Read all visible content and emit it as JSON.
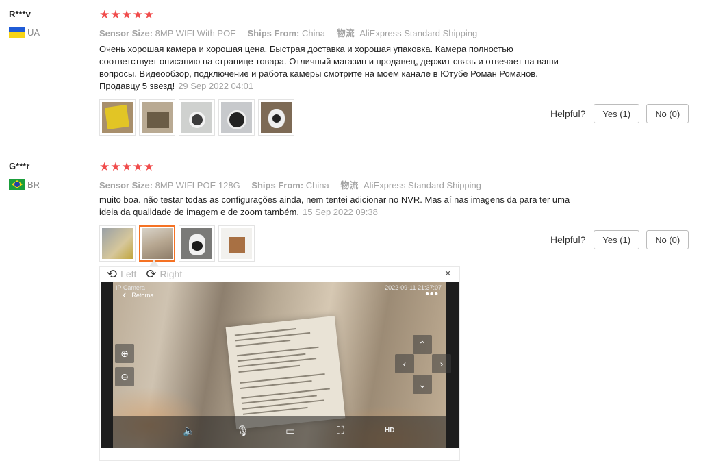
{
  "reviews": [
    {
      "user": "R***v",
      "country": "UA",
      "stars": [
        "★",
        "★",
        "★",
        "★",
        "★"
      ],
      "attrs": [
        {
          "key": "Sensor Size:",
          "value": "8MP WIFI With POE"
        },
        {
          "key": "Ships From:",
          "value": "China"
        }
      ],
      "shipping_icon": "物流",
      "shipping": "AliExpress Standard Shipping",
      "text_lines": [
        "Очень хорошая камера и хорошая цена. Быстрая доставка и хорошая упаковка. Камера полностью",
        "соответствует описанию на странице товара. Отличный магазин и продавец, держит связь и отвечает на ваши",
        "вопросы. Видеообзор, подключение и работа камеры смотрите на моем канале в Ютубе Роман Романов.",
        "Продавцу 5 звезд!"
      ],
      "date": "29 Sep 2022 04:01",
      "helpful_label": "Helpful?",
      "yes_label": "Yes (1)",
      "no_label": "No (0)"
    },
    {
      "user": "G***r",
      "country": "BR",
      "stars": [
        "★",
        "★",
        "★",
        "★",
        "★"
      ],
      "attrs": [
        {
          "key": "Sensor Size:",
          "value": "8MP WIFI POE 128G"
        },
        {
          "key": "Ships From:",
          "value": "China"
        }
      ],
      "shipping_icon": "物流",
      "shipping": "AliExpress Standard Shipping",
      "text_lines": [
        "muito boa. não testar todas as configurações ainda, nem tentei adicionar no NVR. Mas aí nas imagens da para ter uma",
        "ideia da qualidade de imagem e de zoom também."
      ],
      "date": "15 Sep 2022 09:38",
      "helpful_label": "Helpful?",
      "yes_label": "Yes (1)",
      "no_label": "No (0)"
    }
  ],
  "viewer": {
    "rotate_left": "Left",
    "rotate_right": "Right",
    "close_icon": "×",
    "photo": {
      "app_title": "IP Camera",
      "timestamp": "2022-09-11 21:37:07",
      "back_label": "Retorna",
      "hd_label": "HD"
    }
  }
}
